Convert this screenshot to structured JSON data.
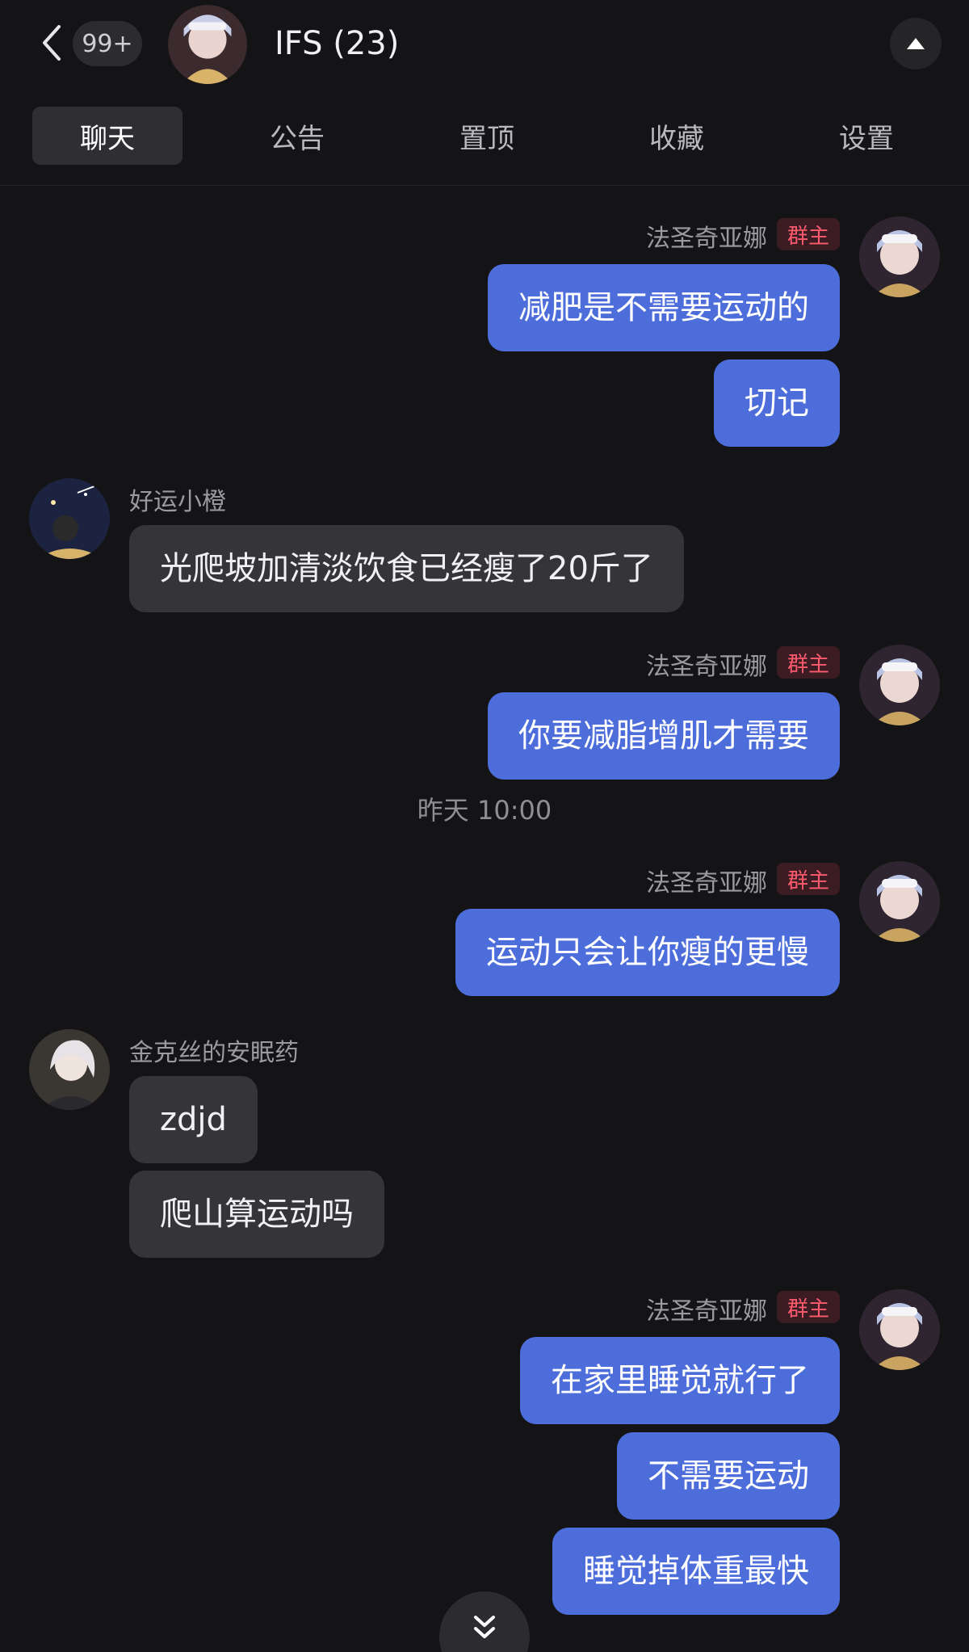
{
  "header": {
    "unread_count": "99+",
    "group_title": "IFS (23)"
  },
  "tabs": [
    "聊天",
    "公告",
    "置顶",
    "收藏",
    "设置"
  ],
  "role_badge": "群主",
  "messages": [
    {
      "sender": "法圣奇亚娜",
      "role": "群主",
      "direction": "out",
      "texts": [
        "减肥是不需要运动的",
        "切记"
      ]
    },
    {
      "sender": "好运小橙",
      "direction": "in",
      "texts": [
        "光爬坡加清淡饮食已经瘦了20斤了"
      ]
    },
    {
      "sender": "法圣奇亚娜",
      "role": "群主",
      "direction": "out",
      "texts": [
        "你要减脂增肌才需要"
      ]
    },
    {
      "timestamp": "昨天 10:00"
    },
    {
      "sender": "法圣奇亚娜",
      "role": "群主",
      "direction": "out",
      "texts": [
        "运动只会让你瘦的更慢"
      ]
    },
    {
      "sender": "金克丝的安眠药",
      "direction": "in",
      "texts": [
        "zdjd",
        "爬山算运动吗"
      ]
    },
    {
      "sender": "法圣奇亚娜",
      "role": "群主",
      "direction": "out",
      "texts": [
        "在家里睡觉就行了",
        "不需要运动",
        "睡觉掉体重最快"
      ]
    }
  ],
  "icons": {
    "back": "chevron-left-icon",
    "collapse": "triangle-up-icon",
    "scroll": "double-chevron-down-icon"
  },
  "colors": {
    "background": "#141416",
    "outgoing_bubble": "#4d6ddb",
    "incoming_bubble": "#353538",
    "owner_badge_text": "#ff5a6e"
  }
}
